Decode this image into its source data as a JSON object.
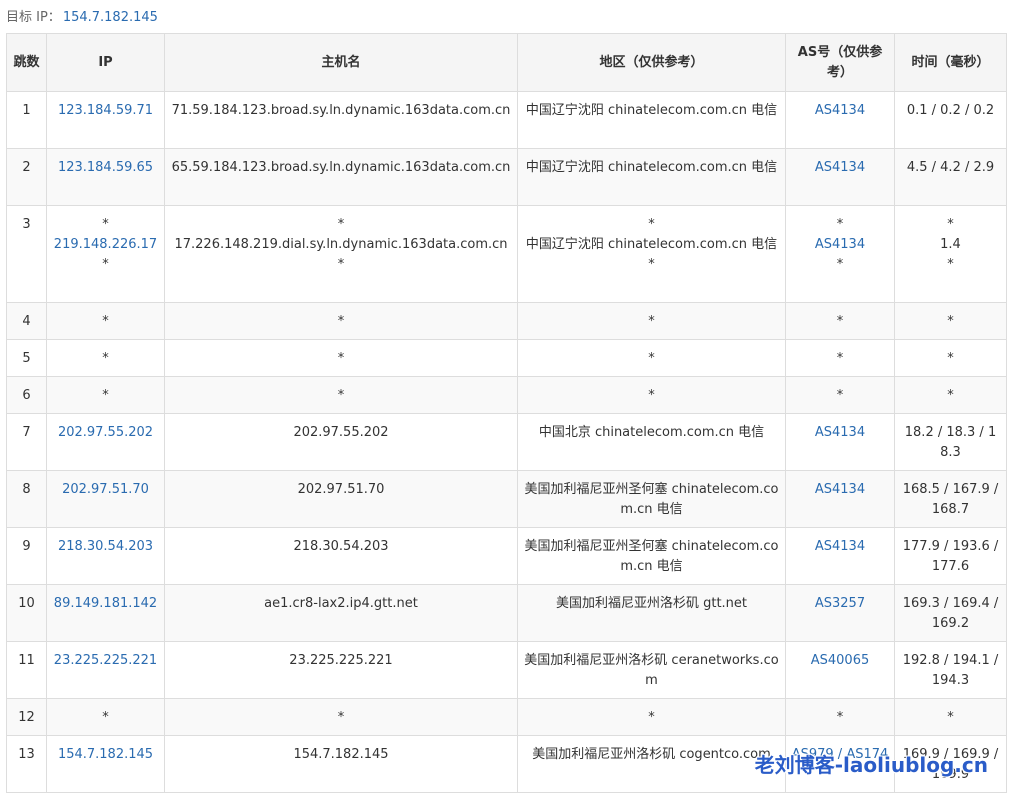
{
  "target": {
    "label": "目标 IP：",
    "ip": "154.7.182.145"
  },
  "columns": [
    "跳数",
    "IP",
    "主机名",
    "地区（仅供参考）",
    "AS号（仅供参考）",
    "时间（毫秒）"
  ],
  "rows": [
    {
      "hop": "1",
      "ip": [
        "123.184.59.71"
      ],
      "host": [
        "71.59.184.123.broad.sy.ln.dynamic.163data.com.cn"
      ],
      "region": [
        "中国辽宁沈阳 chinatelecom.com.cn 电信"
      ],
      "as": [
        "AS4134"
      ],
      "time": [
        "0.1 / 0.2 / 0.2"
      ]
    },
    {
      "hop": "2",
      "ip": [
        "123.184.59.65"
      ],
      "host": [
        "65.59.184.123.broad.sy.ln.dynamic.163data.com.cn"
      ],
      "region": [
        "中国辽宁沈阳 chinatelecom.com.cn 电信"
      ],
      "as": [
        "AS4134"
      ],
      "time": [
        "4.5 / 4.2 / 2.9"
      ]
    },
    {
      "hop": "3",
      "ip": [
        "*",
        "219.148.226.17",
        "*"
      ],
      "host": [
        "*",
        "17.226.148.219.dial.sy.ln.dynamic.163data.com.cn",
        "*"
      ],
      "region": [
        "*",
        "中国辽宁沈阳 chinatelecom.com.cn 电信",
        "*"
      ],
      "as": [
        "*",
        "AS4134",
        "*"
      ],
      "time": [
        "*",
        "1.4",
        "*"
      ]
    },
    {
      "hop": "4",
      "ip": [
        "*"
      ],
      "host": [
        "*"
      ],
      "region": [
        "*"
      ],
      "as": [
        "*"
      ],
      "time": [
        "*"
      ]
    },
    {
      "hop": "5",
      "ip": [
        "*"
      ],
      "host": [
        "*"
      ],
      "region": [
        "*"
      ],
      "as": [
        "*"
      ],
      "time": [
        "*"
      ]
    },
    {
      "hop": "6",
      "ip": [
        "*"
      ],
      "host": [
        "*"
      ],
      "region": [
        "*"
      ],
      "as": [
        "*"
      ],
      "time": [
        "*"
      ]
    },
    {
      "hop": "7",
      "ip": [
        "202.97.55.202"
      ],
      "host": [
        "202.97.55.202"
      ],
      "region": [
        "中国北京 chinatelecom.com.cn 电信"
      ],
      "as": [
        "AS4134"
      ],
      "time": [
        "18.2 / 18.3 / 18.3"
      ]
    },
    {
      "hop": "8",
      "ip": [
        "202.97.51.70"
      ],
      "host": [
        "202.97.51.70"
      ],
      "region": [
        "美国加利福尼亚州圣何塞 chinatelecom.com.cn 电信"
      ],
      "as": [
        "AS4134"
      ],
      "time": [
        "168.5 / 167.9 / 168.7"
      ]
    },
    {
      "hop": "9",
      "ip": [
        "218.30.54.203"
      ],
      "host": [
        "218.30.54.203"
      ],
      "region": [
        "美国加利福尼亚州圣何塞 chinatelecom.com.cn 电信"
      ],
      "as": [
        "AS4134"
      ],
      "time": [
        "177.9 / 193.6 / 177.6"
      ]
    },
    {
      "hop": "10",
      "ip": [
        "89.149.181.142"
      ],
      "host": [
        "ae1.cr8-lax2.ip4.gtt.net"
      ],
      "region": [
        "美国加利福尼亚州洛杉矶 gtt.net"
      ],
      "as": [
        "AS3257"
      ],
      "time": [
        "169.3 / 169.4 / 169.2"
      ]
    },
    {
      "hop": "11",
      "ip": [
        "23.225.225.221"
      ],
      "host": [
        "23.225.225.221"
      ],
      "region": [
        "美国加利福尼亚州洛杉矶 ceranetworks.com"
      ],
      "as": [
        "AS40065"
      ],
      "time": [
        "192.8 / 194.1 / 194.3"
      ]
    },
    {
      "hop": "12",
      "ip": [
        "*"
      ],
      "host": [
        "*"
      ],
      "region": [
        "*"
      ],
      "as": [
        "*"
      ],
      "time": [
        "*"
      ]
    },
    {
      "hop": "13",
      "ip": [
        "154.7.182.145"
      ],
      "host": [
        "154.7.182.145"
      ],
      "region": [
        "美国加利福尼亚州洛杉矶 cogentco.com"
      ],
      "as": [
        "AS979 / AS174"
      ],
      "time": [
        "169.9 / 169.9 / 169.9"
      ]
    }
  ],
  "watermark": "老刘博客-laoliublog.cn",
  "colors": {
    "link": "#2a6bb0",
    "header_bg": "#f5f5f5",
    "border": "#dddddd",
    "watermark": "#2a5cc8"
  }
}
